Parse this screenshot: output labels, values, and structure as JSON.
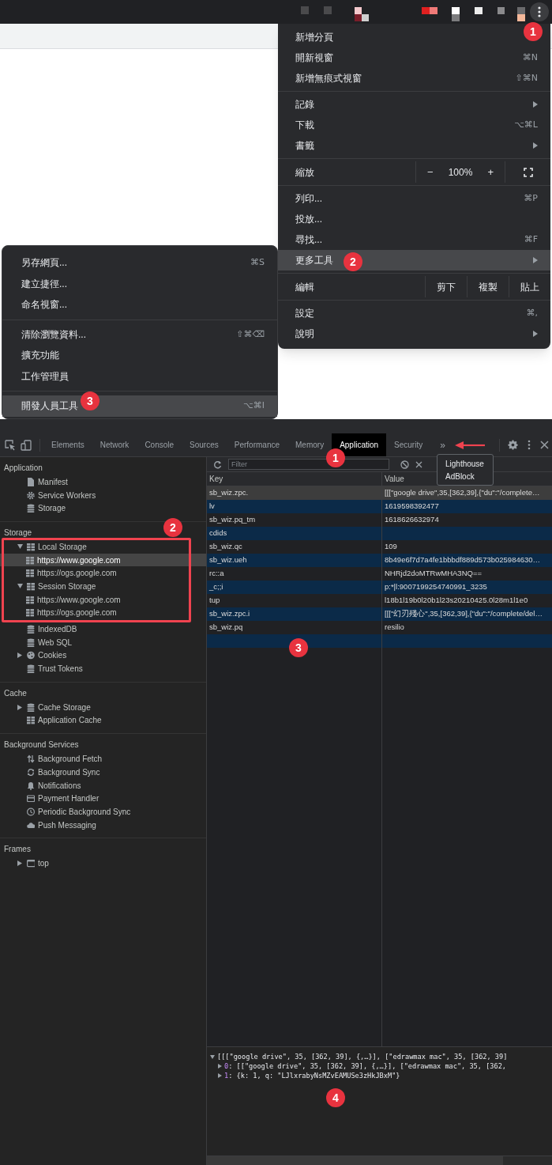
{
  "browser_menu": {
    "groups": [
      [
        {
          "kind": "item",
          "label": "新增分頁",
          "highlighted": false
        },
        {
          "kind": "item",
          "label": "開新視窗",
          "shortcut": "⌘N",
          "highlighted": false
        },
        {
          "kind": "item",
          "label": "新增無痕式視窗",
          "shortcut": "⇧⌘N",
          "highlighted": false
        }
      ],
      [
        {
          "kind": "item",
          "label": "記錄",
          "submenu": true,
          "highlighted": false
        },
        {
          "kind": "item",
          "label": "下載",
          "shortcut": "⌥⌘L",
          "highlighted": false
        },
        {
          "kind": "item",
          "label": "書籤",
          "submenu": true,
          "highlighted": false
        }
      ],
      [
        {
          "kind": "zoom",
          "label": "縮放",
          "minus": "−",
          "value": "100%",
          "plus": "+"
        }
      ],
      [
        {
          "kind": "item",
          "label": "列印...",
          "shortcut": "⌘P",
          "highlighted": false
        },
        {
          "kind": "item",
          "label": "投放...",
          "highlighted": false
        },
        {
          "kind": "item",
          "label": "尋找...",
          "shortcut": "⌘F",
          "highlighted": false
        },
        {
          "kind": "item",
          "label": "更多工具",
          "submenu": true,
          "highlighted": true
        }
      ],
      [
        {
          "kind": "edit",
          "label": "編輯",
          "buttons": [
            "剪下",
            "複製",
            "貼上"
          ]
        }
      ],
      [
        {
          "kind": "item",
          "label": "設定",
          "shortcut": "⌘,",
          "highlighted": false
        },
        {
          "kind": "item",
          "label": "說明",
          "submenu": true,
          "highlighted": false
        }
      ]
    ]
  },
  "more_tools_menu": {
    "groups": [
      [
        {
          "label": "另存網頁...",
          "shortcut": "⌘S",
          "highlighted": false
        },
        {
          "label": "建立捷徑...",
          "highlighted": false
        },
        {
          "label": "命名視窗...",
          "highlighted": false
        }
      ],
      [
        {
          "label": "清除瀏覽資料...",
          "shortcut": "⇧⌘⌫",
          "highlighted": false
        },
        {
          "label": "擴充功能",
          "highlighted": false
        },
        {
          "label": "工作管理員",
          "highlighted": false
        }
      ],
      [
        {
          "label": "開發人員工具",
          "shortcut": "⌥⌘I",
          "highlighted": true
        }
      ]
    ]
  },
  "devtools": {
    "tabs": [
      {
        "label": "Elements",
        "selected": false
      },
      {
        "label": "Network",
        "selected": false
      },
      {
        "label": "Console",
        "selected": false
      },
      {
        "label": "Sources",
        "selected": false
      },
      {
        "label": "Performance",
        "selected": false
      },
      {
        "label": "Memory",
        "selected": false
      },
      {
        "label": "Application",
        "selected": true
      },
      {
        "label": "Security",
        "selected": false
      }
    ],
    "overflow_button": "»",
    "overflow_menu": [
      "Lighthouse",
      "AdBlock"
    ],
    "sidebar": [
      {
        "title": "Application",
        "items": [
          {
            "label": "Manifest",
            "kind": "file",
            "selected": false
          },
          {
            "label": "Service Workers",
            "kind": "gear",
            "selected": false
          },
          {
            "label": "Storage",
            "kind": "database",
            "selected": false
          }
        ]
      },
      {
        "title": "Storage",
        "items": [
          {
            "label": "Local Storage",
            "kind": "grid",
            "expanded": true,
            "selected": false,
            "children": [
              {
                "label": "https://www.google.com",
                "kind": "grid",
                "selected": true
              },
              {
                "label": "https://ogs.google.com",
                "kind": "grid",
                "selected": false
              }
            ]
          },
          {
            "label": "Session Storage",
            "kind": "grid",
            "expanded": true,
            "selected": false,
            "children": [
              {
                "label": "https://www.google.com",
                "kind": "grid",
                "selected": false
              },
              {
                "label": "https://ogs.google.com",
                "kind": "grid",
                "selected": false
              }
            ]
          },
          {
            "label": "IndexedDB",
            "kind": "database",
            "selected": false
          },
          {
            "label": "Web SQL",
            "kind": "database",
            "selected": false
          },
          {
            "label": "Cookies",
            "kind": "cookie",
            "expanded": false,
            "selected": false
          },
          {
            "label": "Trust Tokens",
            "kind": "database",
            "selected": false
          }
        ]
      },
      {
        "title": "Cache",
        "items": [
          {
            "label": "Cache Storage",
            "kind": "database",
            "expanded": false,
            "selected": false
          },
          {
            "label": "Application Cache",
            "kind": "grid",
            "selected": false
          }
        ]
      },
      {
        "title": "Background Services",
        "items": [
          {
            "label": "Background Fetch",
            "kind": "arrows",
            "selected": false
          },
          {
            "label": "Background Sync",
            "kind": "sync",
            "selected": false
          },
          {
            "label": "Notifications",
            "kind": "bell",
            "selected": false
          },
          {
            "label": "Payment Handler",
            "kind": "card",
            "selected": false
          },
          {
            "label": "Periodic Background Sync",
            "kind": "clock",
            "selected": false
          },
          {
            "label": "Push Messaging",
            "kind": "cloud",
            "selected": false
          }
        ]
      },
      {
        "title": "Frames",
        "items": [
          {
            "label": "top",
            "kind": "frame",
            "expanded": false,
            "selected": false
          }
        ]
      }
    ],
    "filter": {
      "placeholder": "Filter"
    },
    "table": {
      "columns": [
        "Key",
        "Value"
      ],
      "rows": [
        {
          "key": "sb_wiz.zpc.",
          "value": "[[[\"google drive\",35,[362,39],{\"du\":\"/complete…",
          "selected": true
        },
        {
          "key": "lv",
          "value": "1619598392477",
          "selected": false
        },
        {
          "key": "sb_wiz.pq_tm",
          "value": "1618626632974",
          "selected": false
        },
        {
          "key": "cdids",
          "selected": false
        },
        {
          "key": "sb_wiz.qc",
          "value": "109",
          "selected": false
        },
        {
          "key": "sb_wiz.ueh",
          "value": "8b49e6f7d7a4fe1bbbdf889d573b025984630…",
          "selected": false
        },
        {
          "key": "rc::a",
          "value": "NHRjd2doMTRwMHA3NQ==",
          "selected": false
        },
        {
          "key": "_c;;i",
          "value": "p:*|l:9007199254740991_3235",
          "selected": false
        },
        {
          "key": "tup",
          "value": "l18b1l19b0l20b1l23s20210425.0l28m1l1e0",
          "selected": false
        },
        {
          "key": "sb_wiz.zpc.i",
          "value": "[[[\"幻刃殘心\",35,[362,39],{\"du\":\"/complete/del…",
          "selected": false
        },
        {
          "key": "sb_wiz.pq",
          "value": "resilio",
          "selected": false
        }
      ]
    },
    "preview": [
      {
        "expanded": true,
        "text": "[[[\"google drive\", 35, [362, 39], {,…}], [\"edrawmax mac\", 35, [362, 39]"
      },
      {
        "expanded": false,
        "index": "0",
        "text": ": [[\"google drive\", 35, [362, 39], {,…}], [\"edrawmax mac\", 35, [362,"
      },
      {
        "expanded": false,
        "index": "1",
        "text": ": {k: 1, q: \"LJlxrabyNsMZvEAMUSe3zHkJBxM\"}"
      }
    ]
  },
  "annotations": [
    "1",
    "2",
    "3",
    "1",
    "2",
    "3",
    "4"
  ]
}
